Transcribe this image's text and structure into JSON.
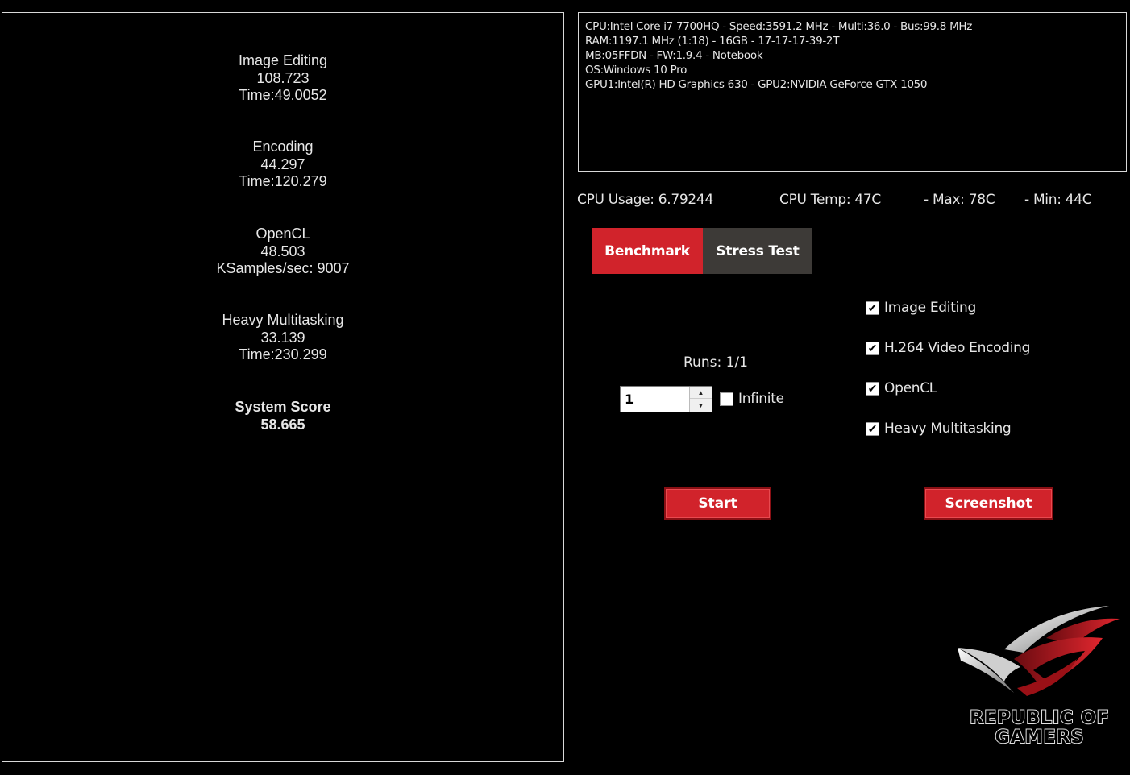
{
  "results": {
    "image_editing": {
      "title": "Image Editing",
      "score": "108.723",
      "detail": "Time:49.0052"
    },
    "encoding": {
      "title": "Encoding",
      "score": "44.297",
      "detail": "Time:120.279"
    },
    "opencl": {
      "title": "OpenCL",
      "score": "48.503",
      "detail": "KSamples/sec: 9007"
    },
    "heavy_multitasking": {
      "title": "Heavy Multitasking",
      "score": "33.139",
      "detail": "Time:230.299"
    },
    "system_score": {
      "title": "System Score",
      "score": "58.665"
    }
  },
  "sysinfo": {
    "cpu": "CPU:Intel Core i7 7700HQ - Speed:3591.2 MHz - Multi:36.0 - Bus:99.8 MHz",
    "ram": "RAM:1197.1 MHz (1:18) - 16GB - 17-17-17-39-2T",
    "mb": "MB:05FFDN - FW:1.9.4 - Notebook",
    "os": "OS:Windows 10 Pro",
    "gpu": "GPU1:Intel(R) HD Graphics 630 - GPU2:NVIDIA GeForce GTX 1050"
  },
  "stats": {
    "cpu_usage": "CPU Usage: 6.79244",
    "cpu_temp": "CPU Temp:  47C",
    "max": "- Max:  78C",
    "min": "- Min:  44C"
  },
  "tabs": {
    "benchmark": "Benchmark",
    "stress_test": "Stress Test"
  },
  "runs": {
    "label": "Runs: 1/1",
    "value": "1",
    "infinite_label": "Infinite",
    "infinite_checked": false
  },
  "tests": [
    {
      "label": "Image Editing",
      "checked": true
    },
    {
      "label": "H.264 Video Encoding",
      "checked": true
    },
    {
      "label": "OpenCL",
      "checked": true
    },
    {
      "label": "Heavy Multitasking",
      "checked": true
    }
  ],
  "buttons": {
    "start": "Start",
    "screenshot": "Screenshot"
  },
  "logo": {
    "line1": "REPUBLIC OF",
    "line2": "GAMERS"
  },
  "colors": {
    "accent_red": "#d1232b",
    "tab_inactive": "#3d3a37",
    "background": "#000000"
  }
}
